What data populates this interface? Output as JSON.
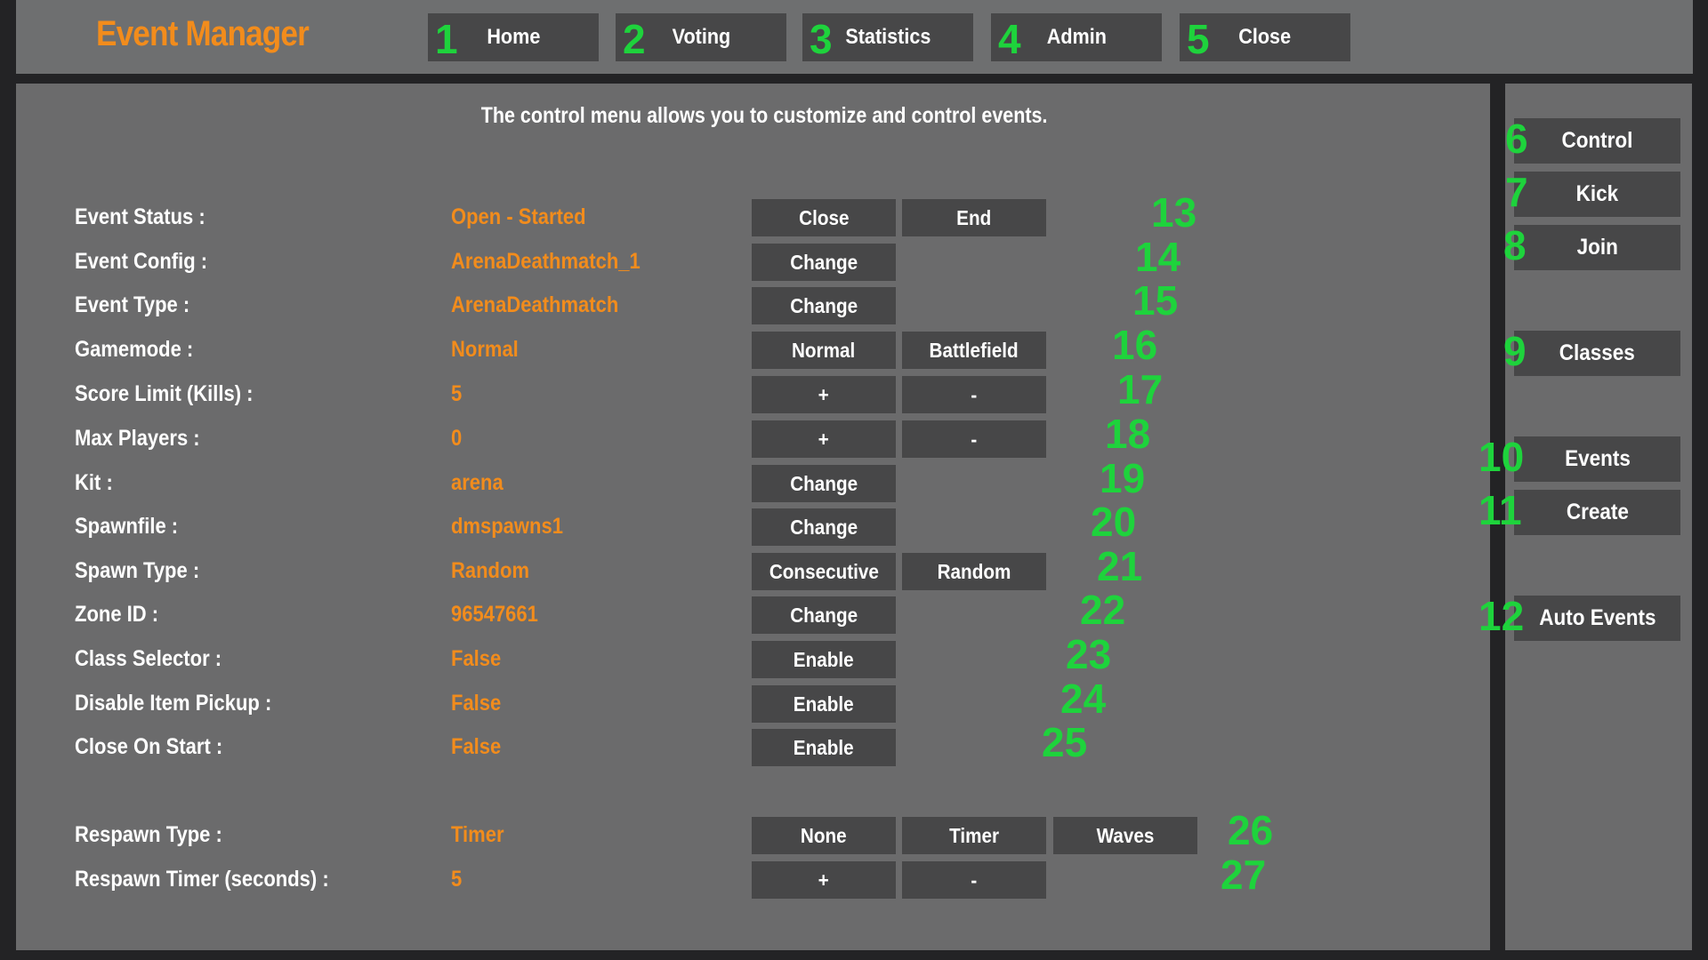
{
  "app": {
    "title": "Event Manager"
  },
  "colors": {
    "accent_orange": "#f28c1c",
    "marker_green": "#1ed33c",
    "panel": "#6b6b6c",
    "button": "#474748"
  },
  "nav": [
    {
      "marker": "1",
      "label": "Home"
    },
    {
      "marker": "2",
      "label": "Voting"
    },
    {
      "marker": "3",
      "label": "Statistics"
    },
    {
      "marker": "4",
      "label": "Admin"
    },
    {
      "marker": "5",
      "label": "Close"
    }
  ],
  "main": {
    "subtitle": "The control menu allows you to customize and control events.",
    "rows": [
      {
        "label": "Event Status  :",
        "value": "Open - Started",
        "buttons": [
          "Close",
          "End"
        ],
        "marker": "13"
      },
      {
        "label": "Event Config  :",
        "value": "ArenaDeathmatch_1",
        "buttons": [
          "Change"
        ],
        "marker": "14"
      },
      {
        "label": "Event Type  :",
        "value": "ArenaDeathmatch",
        "buttons": [
          "Change"
        ],
        "marker": "15"
      },
      {
        "label": "Gamemode  :",
        "value": "Normal",
        "buttons": [
          "Normal",
          "Battlefield"
        ],
        "marker": "16"
      },
      {
        "label": "Score Limit (Kills)  :",
        "value": "5",
        "buttons": [
          "+",
          "-"
        ],
        "marker": "17"
      },
      {
        "label": "Max Players  :",
        "value": "0",
        "buttons": [
          "+",
          "-"
        ],
        "marker": "18"
      },
      {
        "label": "Kit  :",
        "value": "arena",
        "buttons": [
          "Change"
        ],
        "marker": "19"
      },
      {
        "label": "Spawnfile  :",
        "value": "dmspawns1",
        "buttons": [
          "Change"
        ],
        "marker": "20"
      },
      {
        "label": "Spawn Type  :",
        "value": "Random",
        "buttons": [
          "Consecutive",
          "Random"
        ],
        "marker": "21"
      },
      {
        "label": "Zone ID  :",
        "value": "96547661",
        "buttons": [
          "Change"
        ],
        "marker": "22"
      },
      {
        "label": "Class Selector  :",
        "value": "False",
        "buttons": [
          "Enable"
        ],
        "marker": "23"
      },
      {
        "label": "Disable Item Pickup  :",
        "value": "False",
        "buttons": [
          "Enable"
        ],
        "marker": "24"
      },
      {
        "label": "Close On Start  :",
        "value": "False",
        "buttons": [
          "Enable"
        ],
        "marker": "25"
      },
      {
        "label": "Respawn Type  :",
        "value": "Timer",
        "buttons": [
          "None",
          "Timer",
          "Waves"
        ],
        "marker": "26"
      },
      {
        "label": "Respawn Timer (seconds)  :",
        "value": "5",
        "buttons": [
          "+",
          "-"
        ],
        "marker": "27"
      }
    ]
  },
  "sidebar": [
    {
      "marker": "6",
      "label": "Control"
    },
    {
      "marker": "7",
      "label": "Kick"
    },
    {
      "marker": "8",
      "label": "Join"
    },
    {
      "marker": "9",
      "label": "Classes"
    },
    {
      "marker": "10",
      "label": "Events"
    },
    {
      "marker": "11",
      "label": "Create"
    },
    {
      "marker": "12",
      "label": "Auto Events"
    }
  ]
}
